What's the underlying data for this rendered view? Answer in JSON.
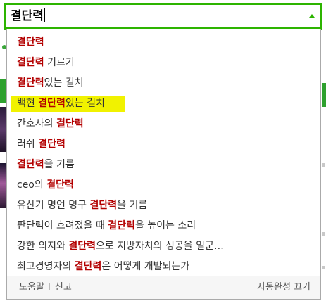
{
  "search": {
    "value": "결단력"
  },
  "suggestions": [
    {
      "before": "",
      "keyword": "결단력",
      "after": ""
    },
    {
      "before": "",
      "keyword": "결단력",
      "after": " 기르기"
    },
    {
      "before": "",
      "keyword": "결단력",
      "after": "있는 길치"
    },
    {
      "before": "백현 ",
      "keyword": "결단력",
      "after": "있는 길치",
      "selected": true
    },
    {
      "before": "간호사의 ",
      "keyword": "결단력",
      "after": ""
    },
    {
      "before": "러쉬 ",
      "keyword": "결단력",
      "after": ""
    },
    {
      "before": "",
      "keyword": "결단력",
      "after": "을 기름"
    },
    {
      "before": "ceo의 ",
      "keyword": "결단력",
      "after": ""
    },
    {
      "before": "유산기 명언 명구 ",
      "keyword": "결단력",
      "after": "을 기름"
    },
    {
      "before": "판단력이 흐려졌을 때 ",
      "keyword": "결단력",
      "after": "을 높이는 소리"
    },
    {
      "before": "강한 의지와 ",
      "keyword": "결단력",
      "after": "으로 지방자치의 성공을 일군…"
    },
    {
      "before": "최고경영자의 ",
      "keyword": "결단력",
      "after": "은 어떻게 개발되는가"
    }
  ],
  "footer": {
    "help": "도움말",
    "report": "신고",
    "autocomplete_off": "자동완성 끄기"
  },
  "colors": {
    "accent": "#2db400",
    "keyword": "#b30000",
    "selected_bg": "#f1f200"
  }
}
